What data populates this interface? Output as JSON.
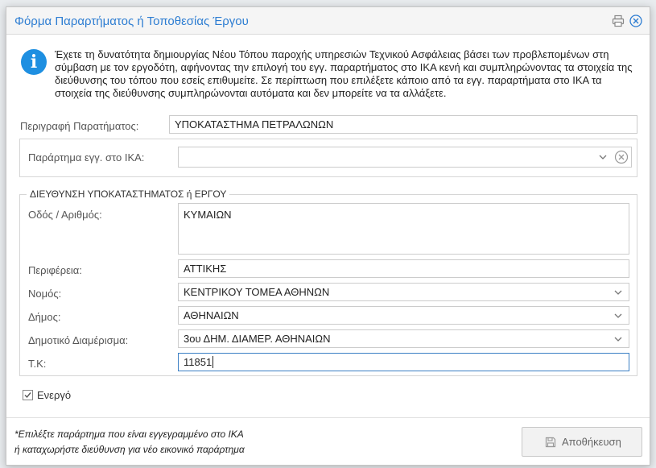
{
  "dialog": {
    "title": "Φόρμα Παραρτήματος ή Τοποθεσίας Έργου",
    "info_text": "Έχετε τη δυνατότητα δημιουργίας Νέου Τόπου παροχής υπηρεσιών Τεχνικού Ασφάλειας βάσει των προβλεπομένων στη σύμβαση με τον εργοδότη, αφήνοντας την επιλογή του εγγ. παραρτήματος στο ΙΚΑ κενή και συμπληρώνοντας τα στοιχεία της διεύθυνσης του τόπου που εσείς επιθυμείτε. Σε περίπτωση που επιλέξετε κάποιο από τα εγγ. παραρτήματα στο ΙΚΑ τα στοιχεία της διεύθυνσης συμπληρώνονται αυτόματα και δεν μπορείτε να τα αλλάξετε."
  },
  "form": {
    "description_label": "Περιγραφή Παρατήματος:",
    "description_value": "ΥΠΟΚΑΤΑΣΤΗΜΑ ΠΕΤΡΑΛΩΝΩΝ",
    "ika_branch_label": "Παράρτημα εγγ. στο ΙΚΑ:",
    "ika_branch_value": "",
    "address_legend": "ΔΙΕΥΘΥΝΣΗ ΥΠΟΚΑΤΑΣΤΗΜΑΤΟΣ ή ΕΡΓΟΥ",
    "street_label": "Οδός / Αριθμός:",
    "street_value": "ΚΥΜΑΙΩΝ",
    "region_label": "Περιφέρεια:",
    "region_value": "ΑΤΤΙΚΗΣ",
    "prefecture_label": "Νομός:",
    "prefecture_value": "ΚΕΝΤΡΙΚΟΥ ΤΟΜΕΑ ΑΘΗΝΩΝ",
    "municipality_label": "Δήμος:",
    "municipality_value": "ΑΘΗΝΑΙΩΝ",
    "district_label": "Δημοτικό Διαμέρισμα:",
    "district_value": "3ου ΔΗΜ. ΔΙΑΜΕΡ. ΑΘΗΝΑΙΩΝ",
    "postcode_label": "Τ.Κ:",
    "postcode_value": "11851",
    "active_label": "Ενεργό",
    "active_checked": true
  },
  "footer": {
    "note_line1": "*Επιλέξτε παράρτημα που είναι εγγεγραμμένο στο ΙΚΑ",
    "note_line2": "ή καταχωρήστε διεύθυνση για νέο εικονικό παράρτημα",
    "save_label": "Αποθήκευση"
  },
  "colors": {
    "title": "#2d7dd2",
    "info_icon": "#1e8fe1",
    "focus_border": "#3b7fc4"
  },
  "icons": [
    "print-icon",
    "close-icon",
    "info-icon",
    "chevron-down-icon",
    "clear-icon",
    "checkbox-icon",
    "save-icon"
  ]
}
